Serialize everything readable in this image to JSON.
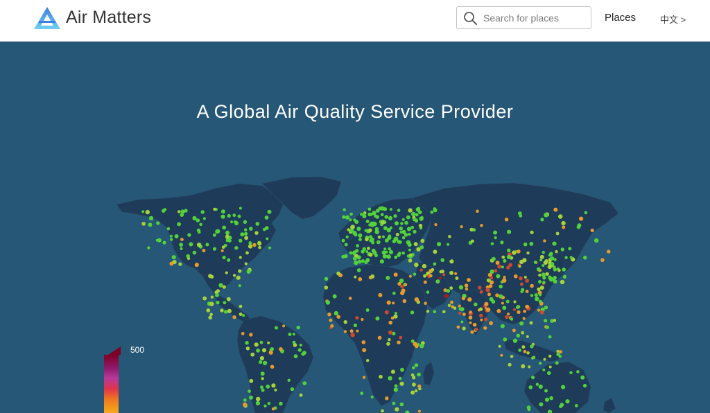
{
  "header": {
    "brand": "Air Matters",
    "search_placeholder": "Search for places",
    "nav_places": "Places",
    "nav_lang": "中文 >"
  },
  "hero": {
    "title": "A Global Air Quality Service Provider",
    "legend_max": "500"
  },
  "colors": {
    "hero_bg": "#265776",
    "land": "#1e3c59",
    "good": "#52d13a",
    "moderate": "#a7d23a",
    "unhealthy": "#e89b2a",
    "very_unhealthy": "#d2482c",
    "hazardous": "#a71c1c"
  },
  "icons": {
    "logo": "air-matters-logo",
    "search": "search-icon"
  }
}
